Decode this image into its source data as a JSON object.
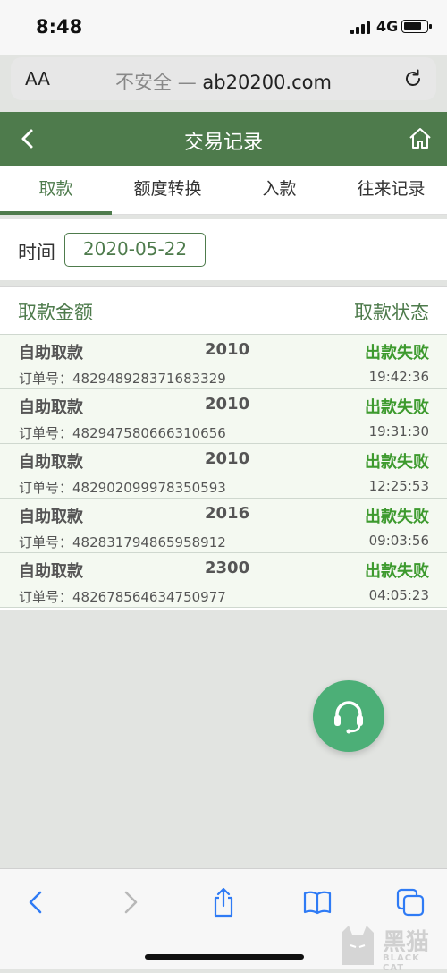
{
  "status_bar": {
    "time": "8:48",
    "network": "4G"
  },
  "browser": {
    "text_size_label": "AA",
    "url_prefix": "不安全 —",
    "url_domain": "ab20200.com"
  },
  "header": {
    "title": "交易记录"
  },
  "tabs": [
    {
      "label": "取款",
      "active": true
    },
    {
      "label": "额度转换",
      "active": false
    },
    {
      "label": "入款",
      "active": false
    },
    {
      "label": "往来记录",
      "active": false
    }
  ],
  "filter": {
    "label": "时间",
    "date": "2020-05-22"
  },
  "list": {
    "amount_header": "取款金额",
    "status_header": "取款状态",
    "order_prefix": "订单号：",
    "rows": [
      {
        "type": "自助取款",
        "amount": "2010",
        "status": "出款失败",
        "order": "482948928371683329",
        "time": "19:42:36"
      },
      {
        "type": "自助取款",
        "amount": "2010",
        "status": "出款失败",
        "order": "482947580666310656",
        "time": "19:31:30"
      },
      {
        "type": "自助取款",
        "amount": "2010",
        "status": "出款失败",
        "order": "482902099978350593",
        "time": "12:25:53"
      },
      {
        "type": "自助取款",
        "amount": "2016",
        "status": "出款失败",
        "order": "482831794865958912",
        "time": "09:03:56"
      },
      {
        "type": "自助取款",
        "amount": "2300",
        "status": "出款失败",
        "order": "482678564634750977",
        "time": "04:05:23"
      }
    ]
  },
  "colors": {
    "header_green": "#4e7b4c",
    "status_green": "#3d9a2e",
    "cs_button": "#4caf77"
  },
  "watermark": {
    "cn": "黑猫",
    "en": "BLACK CAT"
  },
  "icons": [
    "back-arrow-icon",
    "home-icon",
    "reload-icon",
    "headset-icon",
    "share-icon",
    "bookmarks-icon",
    "tabs-icon",
    "forward-arrow-icon"
  ]
}
